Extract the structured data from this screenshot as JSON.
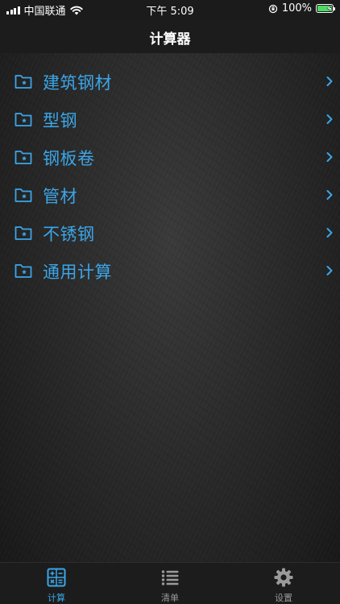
{
  "status_bar": {
    "carrier": "中国联通",
    "time": "下午 5:09",
    "battery": "100%"
  },
  "nav": {
    "title": "计算器"
  },
  "colors": {
    "accent": "#3ba6e8",
    "inactive": "#9a9a9a",
    "battery": "#4cd964"
  },
  "list": {
    "items": [
      {
        "label": "建筑钢材",
        "icon": "folder-star-icon"
      },
      {
        "label": "型钢",
        "icon": "folder-star-icon"
      },
      {
        "label": "钢板卷",
        "icon": "folder-star-icon"
      },
      {
        "label": "管材",
        "icon": "folder-star-icon"
      },
      {
        "label": "不锈钢",
        "icon": "folder-star-icon"
      },
      {
        "label": "通用计算",
        "icon": "folder-star-icon"
      }
    ]
  },
  "tab_bar": {
    "tabs": [
      {
        "label": "计算",
        "icon": "calculator-icon",
        "active": true
      },
      {
        "label": "清单",
        "icon": "list-icon",
        "active": false
      },
      {
        "label": "设置",
        "icon": "gear-icon",
        "active": false
      }
    ]
  }
}
